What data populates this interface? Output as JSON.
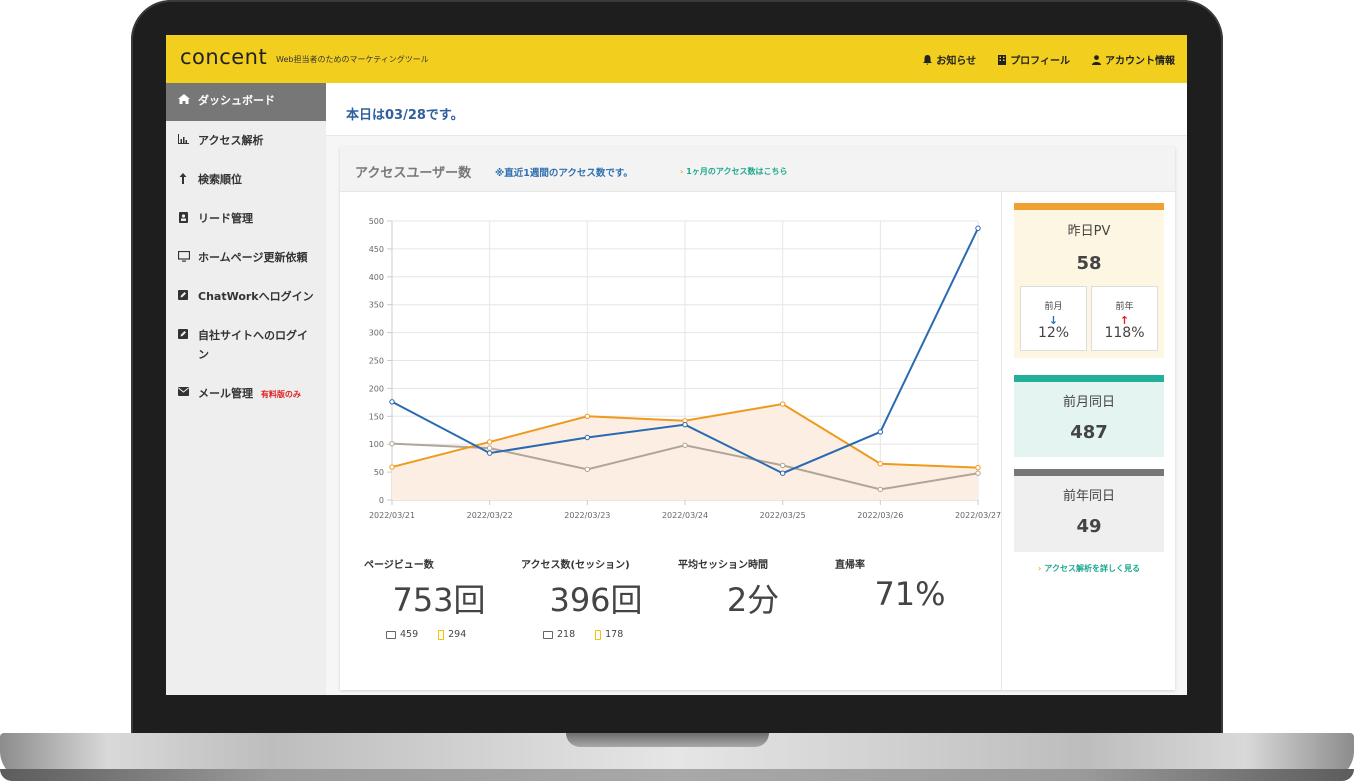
{
  "header": {
    "logo": "concent",
    "tagline": "Web担当者のためのマーケティングツール",
    "nav": [
      {
        "label": "お知らせ",
        "icon": "bell-icon"
      },
      {
        "label": "プロフィール",
        "icon": "building-icon"
      },
      {
        "label": "アカウント情報",
        "icon": "user-icon"
      }
    ]
  },
  "sidebar": {
    "items": [
      {
        "label": "ダッシュボード",
        "icon": "home-icon",
        "active": true
      },
      {
        "label": "アクセス解析",
        "icon": "bar-chart-icon"
      },
      {
        "label": "検索順位",
        "icon": "arrow-up-icon"
      },
      {
        "label": "リード管理",
        "icon": "contact-icon"
      },
      {
        "label": "ホームページ更新依頼",
        "icon": "monitor-icon"
      },
      {
        "label": "ChatWorkへログイン",
        "icon": "edit-icon"
      },
      {
        "label": "自社サイトへのログイン",
        "icon": "edit-icon"
      },
      {
        "label": "メール管理",
        "icon": "mail-icon",
        "badge": "有料版のみ"
      }
    ]
  },
  "main": {
    "date_text": "本日は03/28です。",
    "card": {
      "title": "アクセスユーザー数",
      "note": "※直近1週間のアクセス数です。",
      "link": "1ヶ月のアクセス数はこちら"
    },
    "metrics": [
      {
        "label": "ページビュー数",
        "value": "753回",
        "pc": "459",
        "mobile": "294"
      },
      {
        "label": "アクセス数(セッション)",
        "value": "396回",
        "pc": "218",
        "mobile": "178"
      },
      {
        "label": "平均セッション時間",
        "value": "2分"
      },
      {
        "label": "直帰率",
        "value": "71%"
      }
    ],
    "stats": {
      "yesterday_pv": {
        "label": "昨日PV",
        "value": "58",
        "color": "#f0a030",
        "prev_month": {
          "label": "前月",
          "value": "12%",
          "direction": "down"
        },
        "prev_year": {
          "label": "前年",
          "value": "118%",
          "direction": "up"
        }
      },
      "prev_month_same_day": {
        "label": "前月同日",
        "value": "487",
        "color": "#22b09a"
      },
      "prev_year_same_day": {
        "label": "前年同日",
        "value": "49",
        "color": "#777777"
      },
      "more_link": "アクセス解析を詳しく見る"
    }
  },
  "chart_data": {
    "type": "line",
    "categories": [
      "2022/03/21",
      "2022/03/22",
      "2022/03/23",
      "2022/03/24",
      "2022/03/25",
      "2022/03/26",
      "2022/03/27"
    ],
    "ylim": [
      0,
      500
    ],
    "yticks": [
      0,
      50,
      100,
      150,
      200,
      250,
      300,
      350,
      400,
      450,
      500
    ],
    "series": [
      {
        "color": "#2a6ab0",
        "values": [
          176,
          84,
          112,
          135,
          48,
          122,
          487
        ]
      },
      {
        "color": "#ee9a1e",
        "fill": "#fdeee3",
        "values": [
          59,
          104,
          150,
          142,
          172,
          65,
          58
        ]
      },
      {
        "color": "#b0a59a",
        "values": [
          101,
          93,
          55,
          98,
          62,
          19,
          48
        ]
      }
    ],
    "grid": true
  }
}
